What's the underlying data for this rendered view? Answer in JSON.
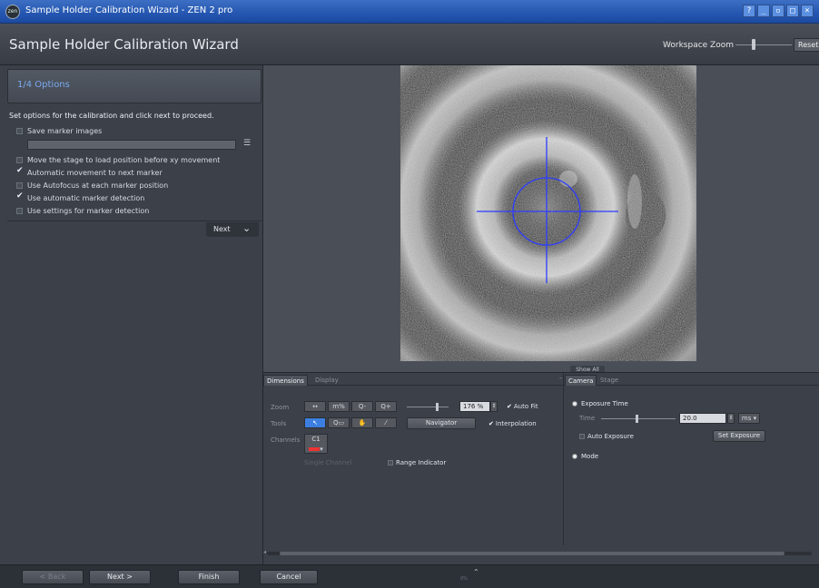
{
  "window": {
    "title": "Sample Holder Calibration Wizard - ZEN 2 pro",
    "app_icon_text": "zen",
    "controls": [
      "?",
      "_",
      "▫",
      "□",
      "×"
    ]
  },
  "header": {
    "title": "Sample Holder Calibration Wizard",
    "workspace_zoom_label": "Workspace Zoom",
    "reset_label": "Reset"
  },
  "left_panel": {
    "step": "1/4  Options",
    "instruction": "Set options for the calibration and click next to proceed.",
    "options": [
      {
        "label": "Save marker images",
        "checked": false
      },
      {
        "label": "Move the stage to load position before xy movement",
        "checked": false
      },
      {
        "label": "Automatic movement to next marker",
        "checked": true
      },
      {
        "label": "Use Autofocus at each marker position",
        "checked": false
      },
      {
        "label": "Use automatic marker detection",
        "checked": true
      },
      {
        "label": "Use settings for marker detection",
        "checked": false
      }
    ],
    "path_value": "",
    "next_label": "Next"
  },
  "preview": {
    "show_all_label": "Show All",
    "crosshair_color": "#2d3cff"
  },
  "dimensions_panel": {
    "tabs": [
      "Dimensions",
      "Display"
    ],
    "zoom_label": "Zoom",
    "tools_label": "Tools",
    "channels_label": "Channels",
    "zoom_buttons": [
      "↔",
      "m%",
      "Q-",
      "Q+"
    ],
    "zoom_value": "176 %",
    "auto_fit_label": "Auto Fit",
    "auto_fit_checked": true,
    "navigator_label": "Navigator",
    "interpolation_label": "Interpolation",
    "interpolation_checked": true,
    "channel_name": "C1",
    "single_channel_label": "Single Channel",
    "range_indicator_label": "Range Indicator",
    "range_indicator_checked": false
  },
  "camera_panel": {
    "tabs": [
      "Camera",
      "Stage"
    ],
    "exposure_time_header": "Exposure Time",
    "time_label": "Time",
    "time_value": "20.0",
    "time_unit": "ms",
    "auto_exposure_label": "Auto Exposure",
    "set_exposure_label": "Set Exposure",
    "mode_header": "Mode"
  },
  "footer": {
    "back_label": "< Back",
    "next_label": "Next >",
    "finish_label": "Finish",
    "cancel_label": "Cancel",
    "progress_text": "0%"
  }
}
